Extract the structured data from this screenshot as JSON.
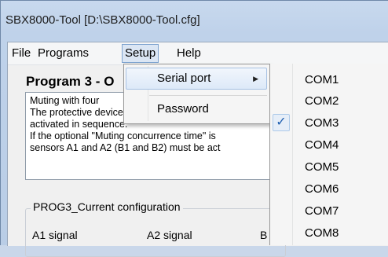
{
  "window": {
    "title": "SBX8000-Tool [D:\\SBX8000-Tool.cfg]"
  },
  "menubar": {
    "items": [
      "File",
      "Programs",
      "Setup",
      "Help"
    ],
    "active": "Setup"
  },
  "program": {
    "title": "Program 3 - O",
    "description_lines": [
      "Muting with four",
      "The protective device (ESPE) is muted if ser",
      "activated in sequence.",
      "If the optional \"Muting concurrence time\" is",
      "sensors A1 and A2 (B1 and B2) must be act"
    ]
  },
  "config": {
    "group_title": "PROG3_Current configuration",
    "columns": [
      "A1 signal",
      "A2 signal",
      "B"
    ]
  },
  "setup_menu": {
    "items": [
      {
        "label": "Serial port",
        "has_submenu": true,
        "submenu_icon": "chevron-right-icon"
      },
      {
        "label": "Password",
        "has_submenu": false
      }
    ]
  },
  "serial_port_menu": {
    "items": [
      "COM1",
      "COM2",
      "COM3",
      "COM4",
      "COM5",
      "COM6",
      "COM7",
      "COM8"
    ],
    "checked": "COM3",
    "check_glyph": "✓",
    "check_icon": "checkmark-icon"
  },
  "colors": {
    "title_bar": "#c8d9ee",
    "menu_highlight": "#dbe6f4",
    "menu_highlight_border": "#7da2ce",
    "check": "#1f5fb0"
  }
}
